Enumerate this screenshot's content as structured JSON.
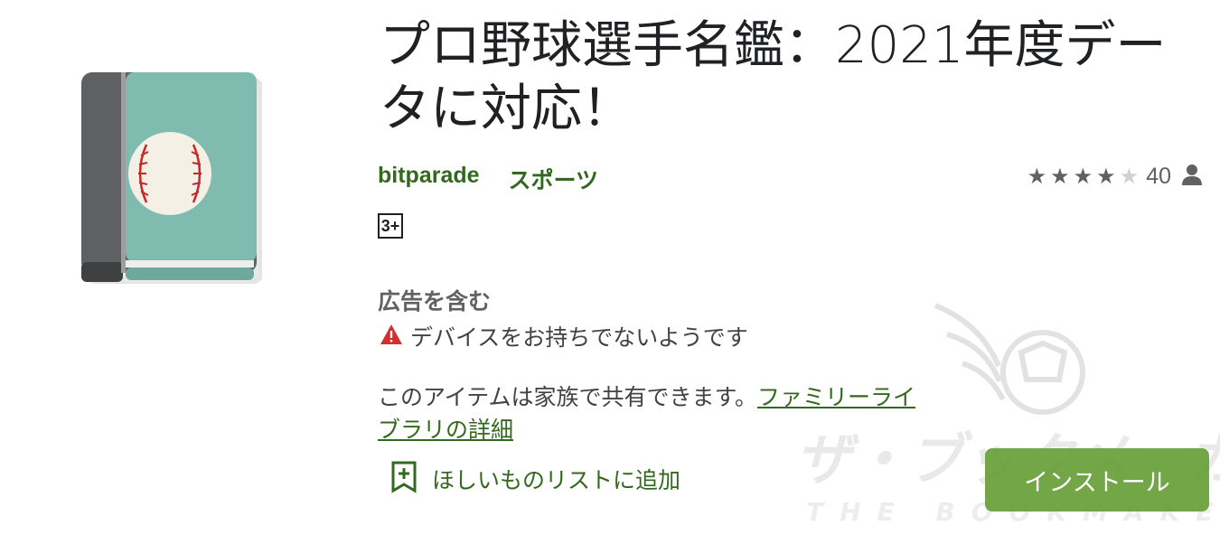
{
  "app": {
    "title": "プロ野球選手名鑑：2021年度データに対応！",
    "developer": "bitparade",
    "category": "スポーツ",
    "content_rating": "3+",
    "rating": 3.5,
    "rating_count": "40",
    "ads_label": "広告を含む",
    "device_warning": "デバイスをお持ちでないようです",
    "family_text": "このアイテムは家族で共有できます。",
    "family_link": "ファミリーライブラリの詳細",
    "wishlist_label": "ほしいものリストに追加",
    "install_label": "インストール"
  },
  "watermark": {
    "jp": "ザ・ブックメーカーズ",
    "en": "THE BOOKMAKERS"
  },
  "colors": {
    "accent": "#33691e",
    "install": "#689f38",
    "warning": "#d32f2f",
    "icon_teal": "#7fbcaf"
  },
  "icons": [
    "app-icon",
    "star-icon",
    "person-icon",
    "warning-icon",
    "wishlist-add-icon"
  ]
}
